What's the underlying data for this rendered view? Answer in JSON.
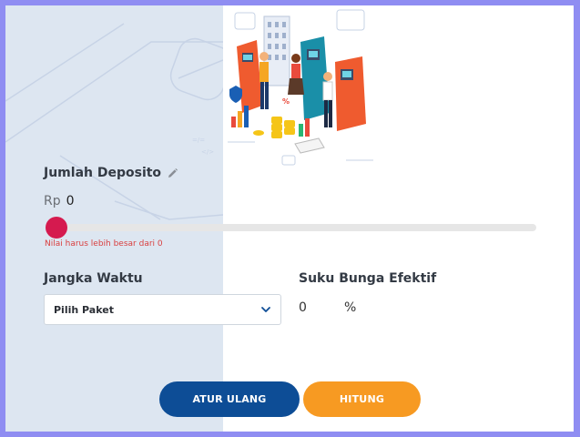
{
  "form": {
    "deposit_label": "Jumlah Deposito",
    "currency": "Rp",
    "amount": "0",
    "slider_value": 0,
    "error_message": "Nilai harus lebih besar dari 0",
    "term_label": "Jangka Waktu",
    "term_placeholder": "Pilih Paket",
    "rate_label": "Suku Bunga Efektif",
    "rate_value": "0",
    "rate_unit": "%"
  },
  "buttons": {
    "reset_label": "ATUR ULANG",
    "calculate_label": "HITUNG"
  },
  "colors": {
    "accent_primary": "#0d4d96",
    "accent_secondary": "#f79a22",
    "slider_thumb": "#d51a4f",
    "error": "#d94040",
    "left_panel": "#dde6f1",
    "page_border": "#8f8df2"
  },
  "icons": {
    "edit": "pencil-icon",
    "dropdown": "chevron-down-icon"
  }
}
